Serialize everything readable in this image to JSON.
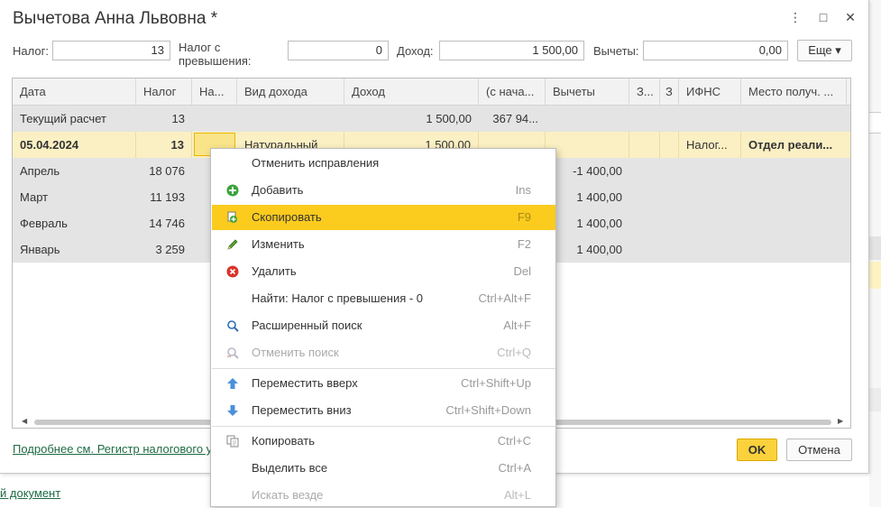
{
  "window": {
    "title": "Вычетова Анна Львовна *",
    "more_icon": "⋮",
    "maximize_icon": "□",
    "close_icon": "✕"
  },
  "fields": {
    "tax_label": "Налог:",
    "tax_value": "13",
    "excess_label": "Налог с превышения:",
    "excess_value": "0",
    "income_label": "Доход:",
    "income_value": "1 500,00",
    "deductions_label": "Вычеты:",
    "deductions_value": "0,00",
    "more_button": "Еще"
  },
  "grid": {
    "columns": [
      "Дата",
      "Налог",
      "На...",
      "Вид дохода",
      "Доход",
      "(с нача...",
      "Вычеты",
      "З...",
      "З",
      "ИФНС",
      "Место получ. ..."
    ],
    "rows": [
      {
        "date": "Текущий расчет",
        "tax": "13",
        "tax2": "",
        "kind": "",
        "income": "1 500,00",
        "cumul": "367 94...",
        "deductions": "",
        "ifns": "",
        "place": ""
      },
      {
        "date": "05.04.2024",
        "tax": "13",
        "tax2": "",
        "kind": "Натуральный",
        "income": "1 500,00",
        "cumul": "",
        "deductions": "",
        "ifns": "Налог...",
        "place": "Отдел реали..."
      },
      {
        "date": "Апрель",
        "tax": "18 076",
        "tax2": "",
        "kind": "",
        "income": "",
        "cumul": "",
        "deductions": "-1 400,00",
        "ifns": "",
        "place": ""
      },
      {
        "date": "Март",
        "tax": "11 193",
        "tax2": "",
        "kind": "",
        "income": "",
        "cumul": "",
        "deductions": "1 400,00",
        "ifns": "",
        "place": ""
      },
      {
        "date": "Февраль",
        "tax": "14 746",
        "tax2": "",
        "kind": "",
        "income": "",
        "cumul": "",
        "deductions": "1 400,00",
        "ifns": "",
        "place": ""
      },
      {
        "date": "Январь",
        "tax": "3 259",
        "tax2": "",
        "kind": "",
        "income": "",
        "cumul": "",
        "deductions": "1 400,00",
        "ifns": "",
        "place": ""
      }
    ]
  },
  "footer": {
    "link": "Подробнее см. Регистр налогового у",
    "ok": "OK",
    "cancel": "Отмена"
  },
  "background": {
    "link": "й документ"
  },
  "context_menu": {
    "items": [
      {
        "label": "Отменить исправления",
        "shortcut": "",
        "icon": "none"
      },
      {
        "label": "Добавить",
        "shortcut": "Ins",
        "icon": "add-icon"
      },
      {
        "label": "Скопировать",
        "shortcut": "F9",
        "icon": "copy-row-icon"
      },
      {
        "label": "Изменить",
        "shortcut": "F2",
        "icon": "pencil-icon"
      },
      {
        "label": "Удалить",
        "shortcut": "Del",
        "icon": "delete-icon"
      },
      {
        "label": "Найти: Налог с превышения - 0",
        "shortcut": "Ctrl+Alt+F",
        "icon": "none"
      },
      {
        "label": "Расширенный поиск",
        "shortcut": "Alt+F",
        "icon": "search-icon"
      },
      {
        "label": "Отменить поиск",
        "shortcut": "Ctrl+Q",
        "icon": "cancel-search-icon"
      },
      {
        "label": "Переместить вверх",
        "shortcut": "Ctrl+Shift+Up",
        "icon": "arrow-up-icon"
      },
      {
        "label": "Переместить вниз",
        "shortcut": "Ctrl+Shift+Down",
        "icon": "arrow-down-icon"
      },
      {
        "label": "Копировать",
        "shortcut": "Ctrl+C",
        "icon": "clipboard-copy-icon"
      },
      {
        "label": "Выделить все",
        "shortcut": "Ctrl+A",
        "icon": "none"
      },
      {
        "label": "Искать везде",
        "shortcut": "Alt+L",
        "icon": "none"
      }
    ]
  },
  "colors": {
    "accent": "#fbcb1e",
    "selected_row": "#fbf0c3",
    "link": "#1e6b43"
  }
}
